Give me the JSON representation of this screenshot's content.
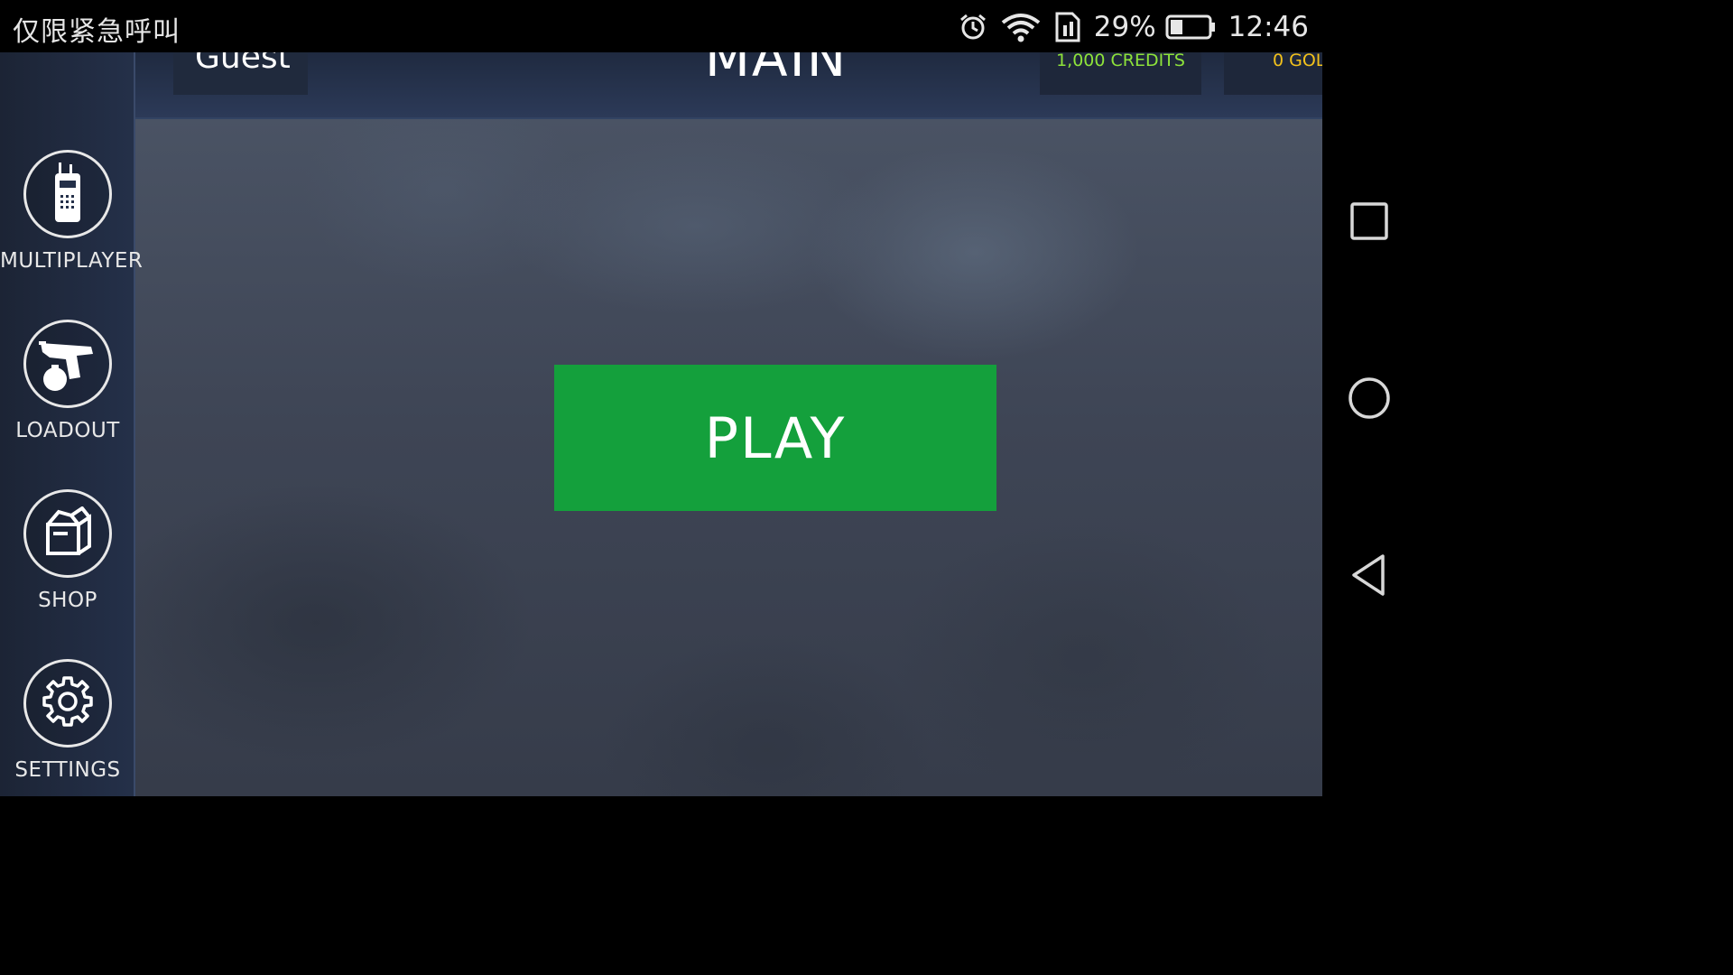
{
  "status_bar": {
    "carrier": "仅限紧急呼叫",
    "battery_percent": "29%",
    "time": "12:46",
    "icons": [
      "alarm-icon",
      "wifi-icon",
      "sim-icon",
      "battery-icon"
    ]
  },
  "header": {
    "player_name": "Guest",
    "title": "MAIN MENU",
    "credits": "1,000 CREDITS",
    "gold": "0 GOL"
  },
  "sidebar": {
    "items": [
      {
        "label": "MULTIPLAYER",
        "icon": "radio-icon"
      },
      {
        "label": "LOADOUT",
        "icon": "pistol-grenade-icon"
      },
      {
        "label": "SHOP",
        "icon": "box-icon"
      },
      {
        "label": "SETTINGS",
        "icon": "gear-icon"
      }
    ]
  },
  "main": {
    "play_label": "PLAY"
  },
  "colors": {
    "play": "#14a03c",
    "credits": "#8ee33a",
    "gold": "#f3c21b",
    "sidebar": "#1c2435"
  },
  "system_nav": {
    "buttons": [
      "recent-apps-icon",
      "home-icon",
      "back-icon"
    ]
  }
}
